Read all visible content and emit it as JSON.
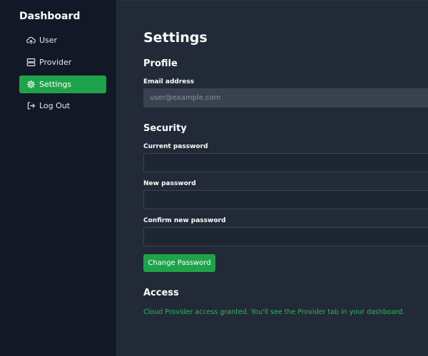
{
  "sidebar": {
    "title": "Dashboard",
    "items": [
      {
        "label": "User",
        "icon": "cloud-upload-icon",
        "active": false
      },
      {
        "label": "Provider",
        "icon": "server-icon",
        "active": false
      },
      {
        "label": "Settings",
        "icon": "gear-icon",
        "active": true
      },
      {
        "label": "Log Out",
        "icon": "logout-icon",
        "active": false
      }
    ]
  },
  "main": {
    "title": "Settings",
    "profile": {
      "heading": "Profile",
      "email_label": "Email address",
      "email_placeholder": "user@example.com"
    },
    "security": {
      "heading": "Security",
      "current_password_label": "Current password",
      "new_password_label": "New password",
      "confirm_password_label": "Confirm new password",
      "button_label": "Change Password"
    },
    "access": {
      "heading": "Access",
      "message": "Cloud Provider access granted. You'll see the Provider tab in your dashboard."
    }
  },
  "colors": {
    "accent": "#1fa34a",
    "success_text": "#2fb65a",
    "sidebar_bg": "#121826",
    "main_bg": "#222a38"
  }
}
